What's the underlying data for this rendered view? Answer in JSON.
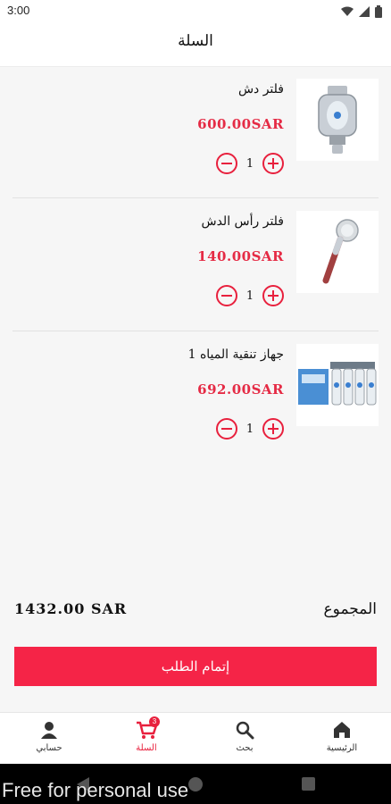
{
  "status": {
    "time": "3:00"
  },
  "header": {
    "title": "السلة"
  },
  "items": [
    {
      "name": "فلتر دش",
      "price": "600.00SAR",
      "qty": "1"
    },
    {
      "name": "فلتر رأس الدش",
      "price": "140.00SAR",
      "qty": "1"
    },
    {
      "name": "جهاز تنقية المياه 1",
      "price": "692.00SAR",
      "qty": "1"
    }
  ],
  "summary": {
    "label": "المجموع",
    "value": "1432.00 SAR"
  },
  "checkout": {
    "label": "إتمام الطلب"
  },
  "nav": {
    "account": "حسابي",
    "cart": "السلة",
    "cart_badge": "3",
    "search": "بحث",
    "home": "الرئيسية"
  },
  "watermark": "Free for personal use",
  "colors": {
    "accent": "#e8203d",
    "button": "#f52447",
    "price": "#e52b45"
  }
}
